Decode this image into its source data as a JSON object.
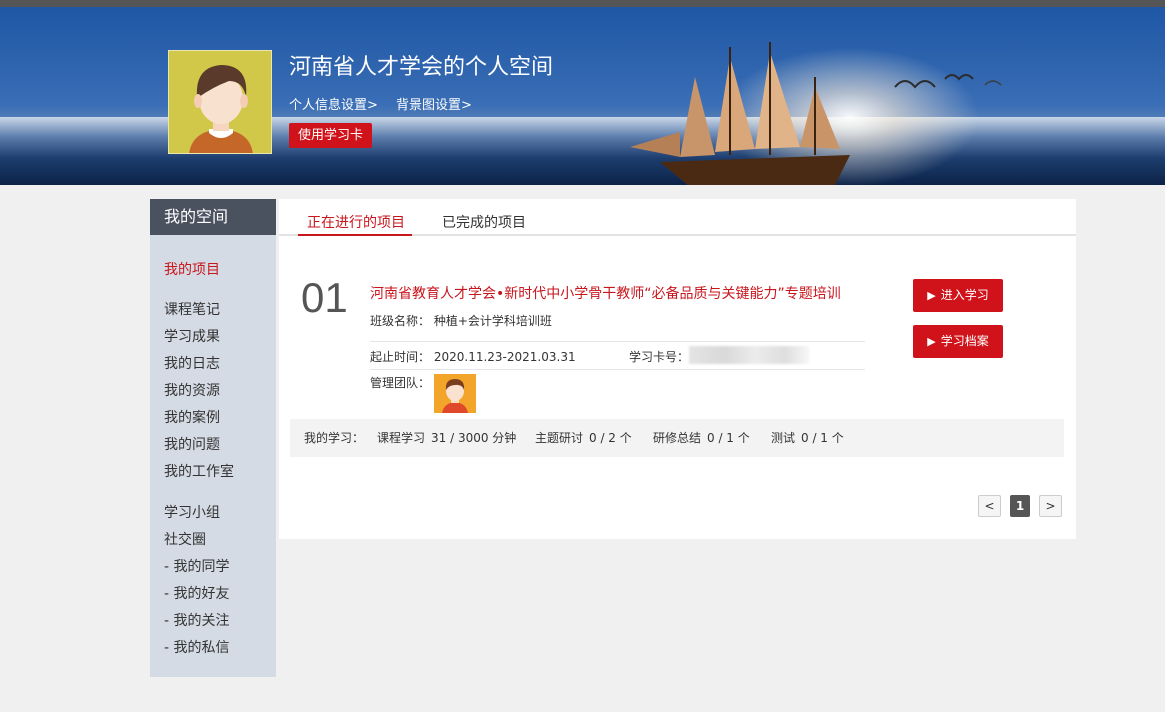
{
  "header": {
    "space_title": "河南省人才学会的个人空间",
    "profile_settings_link": "个人信息设置>",
    "background_settings_link": "背景图设置>",
    "use_card_button": "使用学习卡"
  },
  "sidebar": {
    "title": "我的空间",
    "items": [
      {
        "label": "我的项目",
        "active": true
      },
      {
        "label": "课程笔记"
      },
      {
        "label": "学习成果"
      },
      {
        "label": "我的日志"
      },
      {
        "label": "我的资源"
      },
      {
        "label": "我的案例"
      },
      {
        "label": "我的问题"
      },
      {
        "label": "我的工作室"
      },
      {
        "label": "学习小组"
      },
      {
        "label": "社交圈"
      },
      {
        "label": "- 我的同学"
      },
      {
        "label": "- 我的好友"
      },
      {
        "label": "- 我的关注"
      },
      {
        "label": "- 我的私信"
      }
    ]
  },
  "tabs": [
    {
      "label": "正在进行的项目",
      "active": true
    },
    {
      "label": "已完成的项目"
    }
  ],
  "project": {
    "number": "01",
    "title": "河南省教育人才学会•新时代中小学骨干教师“必备品质与关键能力”专题培训",
    "class_label": "班级名称：",
    "class_name": "种植+会计学科培训班",
    "date_label": "起止时间：",
    "date_range": "2020.11.23-2021.03.31",
    "card_label": "学习卡号：",
    "team_label": "管理团队：",
    "enter_button": "进入学习",
    "archive_button": "学习档案"
  },
  "stats": {
    "my_study_label": "我的学习：",
    "course_label": "课程学习",
    "course_value": "31 / 3000 分钟",
    "topic_label": "主题研讨",
    "topic_value": "0 / 2 个",
    "summary_label": "研修总结",
    "summary_value": "0 / 1 个",
    "test_label": "测试",
    "test_value": "0 / 1 个"
  },
  "pagination": {
    "prev": "<",
    "current": "1",
    "next": ">"
  },
  "colors": {
    "accent_red": "#d0131a",
    "sidebar_bg": "#d5dbe4",
    "sidebar_header": "#4a5260"
  }
}
